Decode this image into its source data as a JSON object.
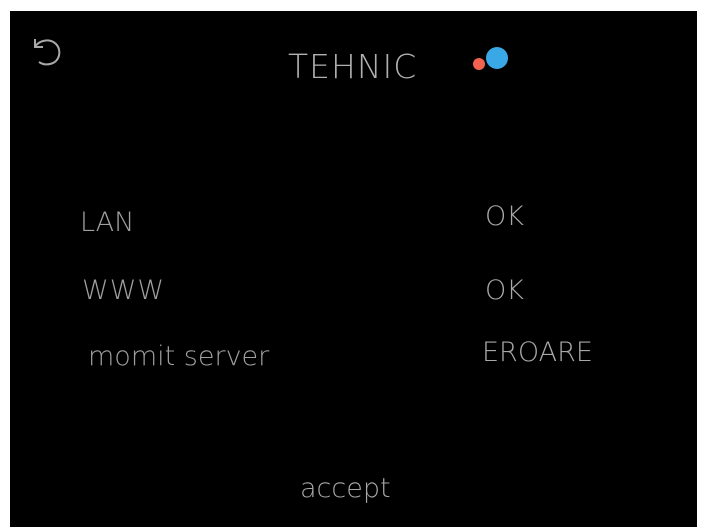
{
  "header": {
    "title": "TEHNIC",
    "back_icon": "undo-arrow-icon",
    "status_dot_colors": [
      "#f2624e",
      "#3aa8e6"
    ]
  },
  "checks": [
    {
      "label": "LAN",
      "value": "OK"
    },
    {
      "label": "WWW",
      "value": "OK"
    },
    {
      "label": "momit server",
      "value": "EROARE"
    }
  ],
  "footer": {
    "accept_label": "accept"
  }
}
